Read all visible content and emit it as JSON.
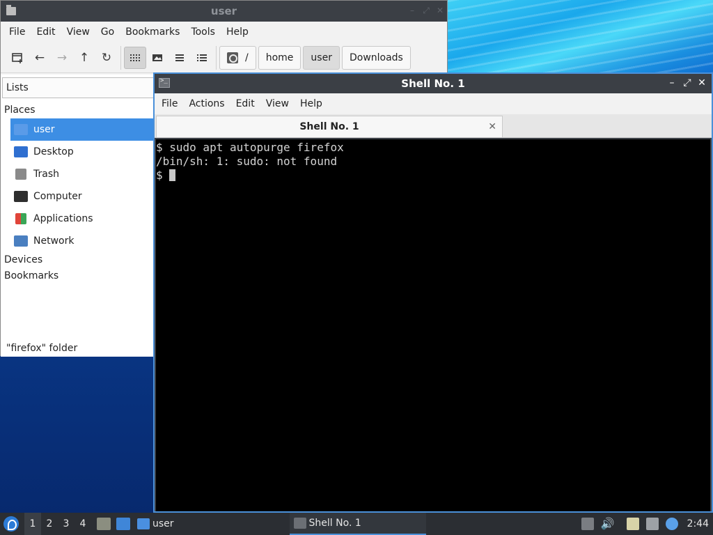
{
  "file_manager": {
    "title": "user",
    "menu": [
      "File",
      "Edit",
      "View",
      "Go",
      "Bookmarks",
      "Tools",
      "Help"
    ],
    "path": {
      "root": "/",
      "crumbs": [
        "home",
        "user",
        "Downloads"
      ]
    },
    "side_pane_mode": "Lists",
    "sections": {
      "places": "Places",
      "devices": "Devices",
      "bookmarks": "Bookmarks"
    },
    "places": [
      {
        "label": "user",
        "icon": "home-folder-icon",
        "color": "#5a9be8"
      },
      {
        "label": "Desktop",
        "icon": "desktop-icon",
        "color": "#2f6fd0"
      },
      {
        "label": "Trash",
        "icon": "trash-icon",
        "color": "#8a8a8a"
      },
      {
        "label": "Computer",
        "icon": "computer-icon",
        "color": "#2e2e2e"
      },
      {
        "label": "Applications",
        "icon": "applications-icon",
        "color": "#e0453a"
      },
      {
        "label": "Network",
        "icon": "network-icon",
        "color": "#4a7fc0"
      }
    ],
    "status_text": "\"firefox\" folder"
  },
  "terminal": {
    "title": "Shell No. 1",
    "menu": [
      "File",
      "Actions",
      "Edit",
      "View",
      "Help"
    ],
    "tab_label": "Shell No. 1",
    "lines": [
      "$ sudo apt autopurge firefox",
      "/bin/sh: 1: sudo: not found",
      "$ "
    ]
  },
  "taskbar": {
    "workspaces": [
      "1",
      "2",
      "3",
      "4"
    ],
    "active_workspace": "1",
    "tasks": [
      {
        "label": "user",
        "icon": "folder-icon"
      },
      {
        "label": "Shell No. 1",
        "icon": "terminal-icon"
      }
    ],
    "clock": "2:44"
  },
  "colors": {
    "selection": "#3d8ee4",
    "titlebar": "#3b3f45",
    "active_border": "#4a90d9"
  }
}
